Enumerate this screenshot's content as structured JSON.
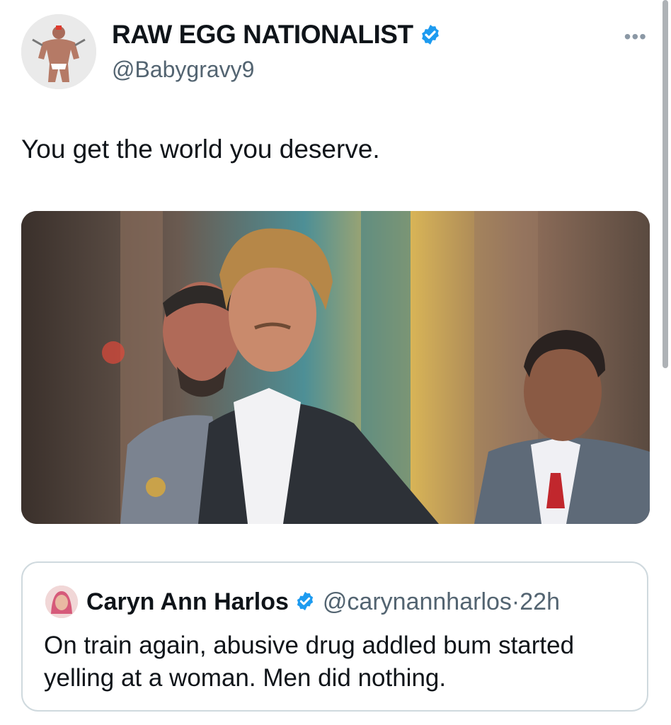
{
  "post": {
    "author_name": "RAW EGG NATIONALIST",
    "author_handle": "@Babygravy9",
    "verified_icon": "verified-badge-icon",
    "more_icon": "more-options-icon",
    "text": "You get the world you deserve."
  },
  "quoted_post": {
    "author_name": "Caryn Ann Harlos",
    "author_handle": "@carynannharlos",
    "separator": "·",
    "time": "22h",
    "text": "On train again, abusive drug addled bum started yelling at a woman.  Men did nothing."
  },
  "colors": {
    "verified": "#1d9bf0",
    "secondary_text": "#536471",
    "border": "#cfd9de"
  }
}
